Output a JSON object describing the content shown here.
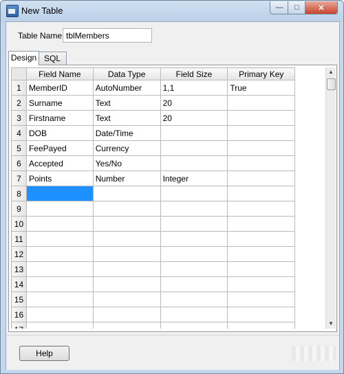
{
  "window": {
    "title": "New Table",
    "minimize_glyph": "—",
    "maximize_glyph": "□",
    "close_glyph": "✕"
  },
  "table_name": {
    "label": "Table Name",
    "value": "tblMembers"
  },
  "tabs": [
    {
      "label": "Design",
      "active": true
    },
    {
      "label": "SQL",
      "active": false
    }
  ],
  "grid": {
    "columns": [
      "Field Name",
      "Data Type",
      "Field Size",
      "Primary Key"
    ],
    "rows": [
      {
        "num": "1",
        "cells": [
          "MemberID",
          "AutoNumber",
          "1,1",
          "True"
        ]
      },
      {
        "num": "2",
        "cells": [
          "Surname",
          "Text",
          "20",
          ""
        ]
      },
      {
        "num": "3",
        "cells": [
          "Firstname",
          "Text",
          "20",
          ""
        ]
      },
      {
        "num": "4",
        "cells": [
          "DOB",
          "Date/Time",
          "",
          ""
        ]
      },
      {
        "num": "5",
        "cells": [
          "FeePayed",
          "Currency",
          "",
          ""
        ]
      },
      {
        "num": "6",
        "cells": [
          "Accepted",
          "Yes/No",
          "",
          ""
        ]
      },
      {
        "num": "7",
        "cells": [
          "Points",
          "Number",
          "Integer",
          ""
        ]
      },
      {
        "num": "8",
        "cells": [
          "",
          "",
          "",
          ""
        ],
        "selected_col": 0
      },
      {
        "num": "9",
        "cells": [
          "",
          "",
          "",
          ""
        ]
      },
      {
        "num": "10",
        "cells": [
          "",
          "",
          "",
          ""
        ]
      },
      {
        "num": "11",
        "cells": [
          "",
          "",
          "",
          ""
        ]
      },
      {
        "num": "12",
        "cells": [
          "",
          "",
          "",
          ""
        ]
      },
      {
        "num": "13",
        "cells": [
          "",
          "",
          "",
          ""
        ]
      },
      {
        "num": "14",
        "cells": [
          "",
          "",
          "",
          ""
        ]
      },
      {
        "num": "15",
        "cells": [
          "",
          "",
          "",
          ""
        ]
      },
      {
        "num": "16",
        "cells": [
          "",
          "",
          "",
          ""
        ]
      },
      {
        "num": "17",
        "cells": [
          "",
          "",
          "",
          ""
        ]
      }
    ]
  },
  "scrollbar": {
    "up_glyph": "▲",
    "down_glyph": "▼"
  },
  "footer": {
    "help_label": "Help"
  },
  "colors": {
    "selection": "#1e90ff",
    "close_button": "#c7442c"
  }
}
